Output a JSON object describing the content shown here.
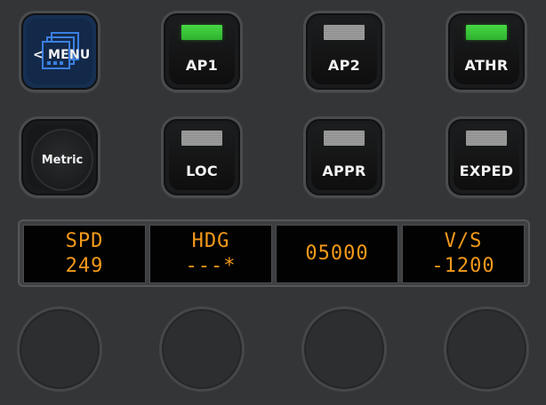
{
  "buttons": {
    "menu": {
      "label": "< MENU"
    },
    "metric": {
      "label": "Metric"
    },
    "ap1": {
      "label": "AP1",
      "lamp": "on"
    },
    "ap2": {
      "label": "AP2",
      "lamp": "off"
    },
    "athr": {
      "label": "ATHR",
      "lamp": "on"
    },
    "loc": {
      "label": "LOC",
      "lamp": "off"
    },
    "appr": {
      "label": "APPR",
      "lamp": "off"
    },
    "exped": {
      "label": "EXPED",
      "lamp": "off"
    }
  },
  "display": {
    "spd": {
      "label": "SPD",
      "value": "249"
    },
    "hdg": {
      "label": "HDG",
      "value": "---*"
    },
    "alt": {
      "value": "05000"
    },
    "vs": {
      "label": "V/S",
      "value": "-1200"
    }
  },
  "colors": {
    "background": "#333537",
    "lamp_on": "#46d845",
    "lamp_off": "#9a9a9a",
    "display_text": "#f59a1a",
    "menu_key": "#162f52"
  },
  "icons": {
    "menu": "stacked-windows-icon",
    "dials": [
      "rotary-dial",
      "rotary-dial",
      "rotary-dial",
      "rotary-dial"
    ]
  }
}
